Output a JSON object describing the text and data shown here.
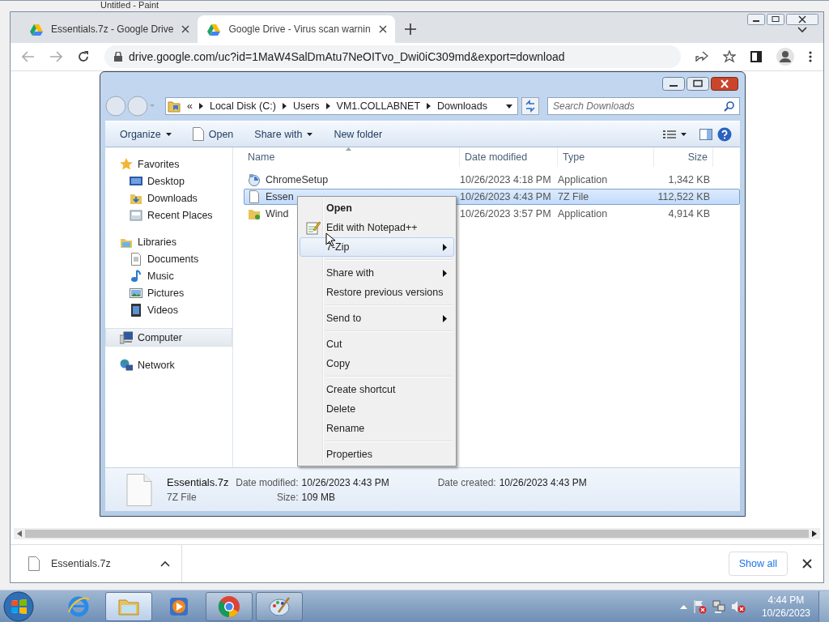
{
  "paint_window": {
    "title": "Untitled - Paint"
  },
  "browser": {
    "tabs": [
      {
        "title": "Essentials.7z - Google Drive",
        "selected": false
      },
      {
        "title": "Google Drive - Virus scan warnin",
        "selected": true
      }
    ],
    "address": "drive.google.com/uc?id=1MaW4SalDmAtu7NeOITvo_Dwi0iC309md&export=download",
    "download_bar": {
      "file": "Essentials.7z",
      "show_all": "Show all"
    }
  },
  "explorer": {
    "breadcrumb_prefix": "«",
    "breadcrumb": [
      "Local Disk (C:)",
      "Users",
      "VM1.COLLABNET",
      "Downloads"
    ],
    "search": {
      "placeholder": "Search Downloads"
    },
    "toolbar": [
      {
        "label": "Organize",
        "dropdown": true,
        "kind": "plain"
      },
      {
        "label": "Open",
        "dropdown": false,
        "kind": "file"
      },
      {
        "label": "Share with",
        "dropdown": true,
        "kind": "plain"
      },
      {
        "label": "New folder",
        "dropdown": false,
        "kind": "plain"
      }
    ],
    "nav": [
      {
        "label": "Favorites",
        "kind": "star",
        "selected": false,
        "children": [
          {
            "label": "Desktop",
            "kind": "desktop"
          },
          {
            "label": "Downloads",
            "kind": "downloads"
          },
          {
            "label": "Recent Places",
            "kind": "recent"
          }
        ]
      },
      {
        "label": "Libraries",
        "kind": "libraries",
        "selected": false,
        "children": [
          {
            "label": "Documents",
            "kind": "documents"
          },
          {
            "label": "Music",
            "kind": "music"
          },
          {
            "label": "Pictures",
            "kind": "pictures"
          },
          {
            "label": "Videos",
            "kind": "videos"
          }
        ]
      },
      {
        "label": "Computer",
        "kind": "computer",
        "selected": true
      },
      {
        "label": "Network",
        "kind": "network",
        "selected": false
      }
    ],
    "columns": [
      "Name",
      "Date modified",
      "Type",
      "Size"
    ],
    "rows": [
      {
        "kind": "setup",
        "name": "ChromeSetup",
        "date": "10/26/2023 4:18 PM",
        "type": "Application",
        "size": "1,342 KB",
        "selected": false
      },
      {
        "kind": "file",
        "name": "Essen",
        "date": "10/26/2023 4:43 PM",
        "type": "7Z File",
        "size": "112,522 KB",
        "selected": true
      },
      {
        "kind": "app",
        "name": "Wind",
        "date": "10/26/2023 3:57 PM",
        "type": "Application",
        "size": "4,914 KB",
        "selected": false
      }
    ],
    "context_menu": [
      {
        "kind": "item",
        "label": "Open",
        "bold": true,
        "has_icon": false,
        "submenu": false,
        "selected": false
      },
      {
        "kind": "item",
        "label": "Edit with Notepad++",
        "bold": false,
        "has_icon": true,
        "submenu": false,
        "selected": false
      },
      {
        "kind": "item",
        "label": "7-Zip",
        "bold": false,
        "has_icon": false,
        "submenu": true,
        "selected": true
      },
      {
        "kind": "separator"
      },
      {
        "kind": "item",
        "label": "Share with",
        "bold": false,
        "has_icon": false,
        "submenu": true,
        "selected": false
      },
      {
        "kind": "item",
        "label": "Restore previous versions",
        "bold": false,
        "has_icon": false,
        "submenu": false,
        "selected": false
      },
      {
        "kind": "separator"
      },
      {
        "kind": "item",
        "label": "Send to",
        "bold": false,
        "has_icon": false,
        "submenu": true,
        "selected": false
      },
      {
        "kind": "separator"
      },
      {
        "kind": "item",
        "label": "Cut",
        "bold": false,
        "has_icon": false,
        "submenu": false,
        "selected": false
      },
      {
        "kind": "item",
        "label": "Copy",
        "bold": false,
        "has_icon": false,
        "submenu": false,
        "selected": false
      },
      {
        "kind": "separator"
      },
      {
        "kind": "item",
        "label": "Create shortcut",
        "bold": false,
        "has_icon": false,
        "submenu": false,
        "selected": false
      },
      {
        "kind": "item",
        "label": "Delete",
        "bold": false,
        "has_icon": false,
        "submenu": false,
        "selected": false
      },
      {
        "kind": "item",
        "label": "Rename",
        "bold": false,
        "has_icon": false,
        "submenu": false,
        "selected": false
      },
      {
        "kind": "separator"
      },
      {
        "kind": "item",
        "label": "Properties",
        "bold": false,
        "has_icon": false,
        "submenu": false,
        "selected": false
      }
    ],
    "details": {
      "name": "Essentials.7z",
      "type": "7Z File",
      "fields": [
        {
          "label": "Date modified:",
          "value": "10/26/2023 4:43 PM"
        },
        {
          "label": "Size:",
          "value": "109 MB"
        },
        {
          "label": "Date created:",
          "value": "10/26/2023 4:43 PM"
        }
      ]
    }
  },
  "taskbar": {
    "apps": [
      {
        "kind": "ie",
        "running": false,
        "selected": false
      },
      {
        "kind": "explorer",
        "running": true,
        "selected": true
      },
      {
        "kind": "media",
        "running": false,
        "selected": false
      },
      {
        "kind": "chrome",
        "running": true,
        "selected": false
      },
      {
        "kind": "paint",
        "running": true,
        "selected": false
      }
    ],
    "clock": {
      "time": "4:44 PM",
      "date": "10/26/2023"
    }
  }
}
